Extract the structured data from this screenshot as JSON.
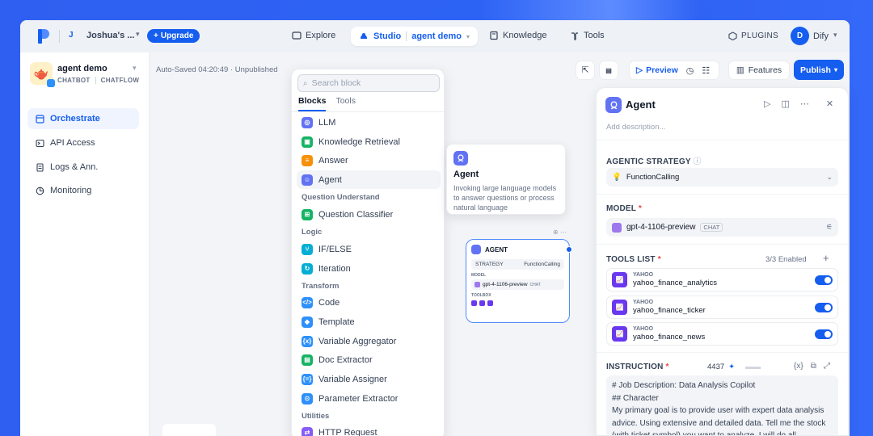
{
  "topbar": {
    "workspace_initial": "J",
    "workspace_name": "Joshua's ...",
    "upgrade_label": "Upgrade",
    "nav": {
      "explore": "Explore",
      "studio": "Studio",
      "current_app": "agent demo",
      "knowledge": "Knowledge",
      "tools": "Tools"
    },
    "plugins_label": "PLUGINS",
    "user_initial": "D",
    "user_name": "Dify"
  },
  "sidebar": {
    "app_name": "agent demo",
    "app_tags": [
      "CHATBOT",
      "CHATFLOW"
    ],
    "items": [
      {
        "label": "Orchestrate",
        "active": true
      },
      {
        "label": "API Access",
        "active": false
      },
      {
        "label": "Logs & Ann.",
        "active": false
      },
      {
        "label": "Monitoring",
        "active": false
      }
    ]
  },
  "canvas": {
    "autosave_status": "Auto-Saved 04:20:49 · Unpublished",
    "preview_label": "Preview",
    "features_label": "Features",
    "publish_label": "Publish"
  },
  "block_selector": {
    "search_placeholder": "Search block",
    "tabs": [
      "Blocks",
      "Tools"
    ],
    "categories": {
      "question_understand": "Question Understand",
      "logic": "Logic",
      "transform": "Transform",
      "utilities": "Utilities"
    },
    "blocks": {
      "llm": "LLM",
      "knowledge_retrieval": "Knowledge Retrieval",
      "answer": "Answer",
      "agent": "Agent",
      "question_classifier": "Question Classifier",
      "if_else": "IF/ELSE",
      "iteration": "Iteration",
      "code": "Code",
      "template": "Template",
      "variable_aggregator": "Variable Aggregator",
      "doc_extractor": "Doc Extractor",
      "variable_assigner": "Variable Assigner",
      "parameter_extractor": "Parameter Extractor",
      "http_request": "HTTP Request"
    }
  },
  "tooltip": {
    "title": "Agent",
    "description": "Invoking large language models to answer questions or process natural language"
  },
  "agent_node": {
    "title": "AGENT",
    "strategy_label": "STRATEGY",
    "strategy_value": "FunctionCalling",
    "model_label": "MODEL",
    "model_value": "gpt-4-1106-preview",
    "model_tag": "CHAT",
    "toolbox_label": "TOOLBOX"
  },
  "panel": {
    "title": "Agent",
    "description_placeholder": "Add description...",
    "strategy_label": "AGENTIC STRATEGY",
    "strategy_value": "FunctionCalling",
    "model_label": "MODEL",
    "model_value": "gpt-4-1106-preview",
    "model_tag": "CHAT",
    "tools_label": "TOOLS LIST",
    "tools_enabled": "3/3 Enabled",
    "tools": [
      {
        "provider": "YAHOO",
        "name": "yahoo_finance_analytics",
        "enabled": true
      },
      {
        "provider": "YAHOO",
        "name": "yahoo_finance_ticker",
        "enabled": true
      },
      {
        "provider": "YAHOO",
        "name": "yahoo_finance_news",
        "enabled": true
      }
    ],
    "instruction_label": "INSTRUCTION",
    "instruction_count": "4437",
    "instruction_lines": [
      "# Job Description: Data Analysis Copilot",
      "## Character",
      "My primary goal is to provide user with expert data analysis",
      "advice. Using extensive and detailed data. Tell me the stock",
      "(with ticket symbol) you want to analyze. I will do all"
    ]
  }
}
